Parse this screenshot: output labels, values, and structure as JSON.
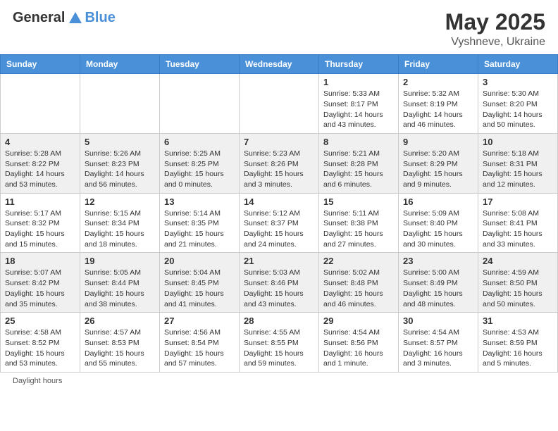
{
  "header": {
    "logo_general": "General",
    "logo_blue": "Blue",
    "month_title": "May 2025",
    "location": "Vyshneve, Ukraine"
  },
  "calendar": {
    "days_of_week": [
      "Sunday",
      "Monday",
      "Tuesday",
      "Wednesday",
      "Thursday",
      "Friday",
      "Saturday"
    ],
    "weeks": [
      [
        {
          "day": "",
          "info": ""
        },
        {
          "day": "",
          "info": ""
        },
        {
          "day": "",
          "info": ""
        },
        {
          "day": "",
          "info": ""
        },
        {
          "day": "1",
          "info": "Sunrise: 5:33 AM\nSunset: 8:17 PM\nDaylight: 14 hours\nand 43 minutes."
        },
        {
          "day": "2",
          "info": "Sunrise: 5:32 AM\nSunset: 8:19 PM\nDaylight: 14 hours\nand 46 minutes."
        },
        {
          "day": "3",
          "info": "Sunrise: 5:30 AM\nSunset: 8:20 PM\nDaylight: 14 hours\nand 50 minutes."
        }
      ],
      [
        {
          "day": "4",
          "info": "Sunrise: 5:28 AM\nSunset: 8:22 PM\nDaylight: 14 hours\nand 53 minutes."
        },
        {
          "day": "5",
          "info": "Sunrise: 5:26 AM\nSunset: 8:23 PM\nDaylight: 14 hours\nand 56 minutes."
        },
        {
          "day": "6",
          "info": "Sunrise: 5:25 AM\nSunset: 8:25 PM\nDaylight: 15 hours\nand 0 minutes."
        },
        {
          "day": "7",
          "info": "Sunrise: 5:23 AM\nSunset: 8:26 PM\nDaylight: 15 hours\nand 3 minutes."
        },
        {
          "day": "8",
          "info": "Sunrise: 5:21 AM\nSunset: 8:28 PM\nDaylight: 15 hours\nand 6 minutes."
        },
        {
          "day": "9",
          "info": "Sunrise: 5:20 AM\nSunset: 8:29 PM\nDaylight: 15 hours\nand 9 minutes."
        },
        {
          "day": "10",
          "info": "Sunrise: 5:18 AM\nSunset: 8:31 PM\nDaylight: 15 hours\nand 12 minutes."
        }
      ],
      [
        {
          "day": "11",
          "info": "Sunrise: 5:17 AM\nSunset: 8:32 PM\nDaylight: 15 hours\nand 15 minutes."
        },
        {
          "day": "12",
          "info": "Sunrise: 5:15 AM\nSunset: 8:34 PM\nDaylight: 15 hours\nand 18 minutes."
        },
        {
          "day": "13",
          "info": "Sunrise: 5:14 AM\nSunset: 8:35 PM\nDaylight: 15 hours\nand 21 minutes."
        },
        {
          "day": "14",
          "info": "Sunrise: 5:12 AM\nSunset: 8:37 PM\nDaylight: 15 hours\nand 24 minutes."
        },
        {
          "day": "15",
          "info": "Sunrise: 5:11 AM\nSunset: 8:38 PM\nDaylight: 15 hours\nand 27 minutes."
        },
        {
          "day": "16",
          "info": "Sunrise: 5:09 AM\nSunset: 8:40 PM\nDaylight: 15 hours\nand 30 minutes."
        },
        {
          "day": "17",
          "info": "Sunrise: 5:08 AM\nSunset: 8:41 PM\nDaylight: 15 hours\nand 33 minutes."
        }
      ],
      [
        {
          "day": "18",
          "info": "Sunrise: 5:07 AM\nSunset: 8:42 PM\nDaylight: 15 hours\nand 35 minutes."
        },
        {
          "day": "19",
          "info": "Sunrise: 5:05 AM\nSunset: 8:44 PM\nDaylight: 15 hours\nand 38 minutes."
        },
        {
          "day": "20",
          "info": "Sunrise: 5:04 AM\nSunset: 8:45 PM\nDaylight: 15 hours\nand 41 minutes."
        },
        {
          "day": "21",
          "info": "Sunrise: 5:03 AM\nSunset: 8:46 PM\nDaylight: 15 hours\nand 43 minutes."
        },
        {
          "day": "22",
          "info": "Sunrise: 5:02 AM\nSunset: 8:48 PM\nDaylight: 15 hours\nand 46 minutes."
        },
        {
          "day": "23",
          "info": "Sunrise: 5:00 AM\nSunset: 8:49 PM\nDaylight: 15 hours\nand 48 minutes."
        },
        {
          "day": "24",
          "info": "Sunrise: 4:59 AM\nSunset: 8:50 PM\nDaylight: 15 hours\nand 50 minutes."
        }
      ],
      [
        {
          "day": "25",
          "info": "Sunrise: 4:58 AM\nSunset: 8:52 PM\nDaylight: 15 hours\nand 53 minutes."
        },
        {
          "day": "26",
          "info": "Sunrise: 4:57 AM\nSunset: 8:53 PM\nDaylight: 15 hours\nand 55 minutes."
        },
        {
          "day": "27",
          "info": "Sunrise: 4:56 AM\nSunset: 8:54 PM\nDaylight: 15 hours\nand 57 minutes."
        },
        {
          "day": "28",
          "info": "Sunrise: 4:55 AM\nSunset: 8:55 PM\nDaylight: 15 hours\nand 59 minutes."
        },
        {
          "day": "29",
          "info": "Sunrise: 4:54 AM\nSunset: 8:56 PM\nDaylight: 16 hours\nand 1 minute."
        },
        {
          "day": "30",
          "info": "Sunrise: 4:54 AM\nSunset: 8:57 PM\nDaylight: 16 hours\nand 3 minutes."
        },
        {
          "day": "31",
          "info": "Sunrise: 4:53 AM\nSunset: 8:59 PM\nDaylight: 16 hours\nand 5 minutes."
        }
      ]
    ]
  },
  "footer": {
    "note": "Daylight hours"
  }
}
